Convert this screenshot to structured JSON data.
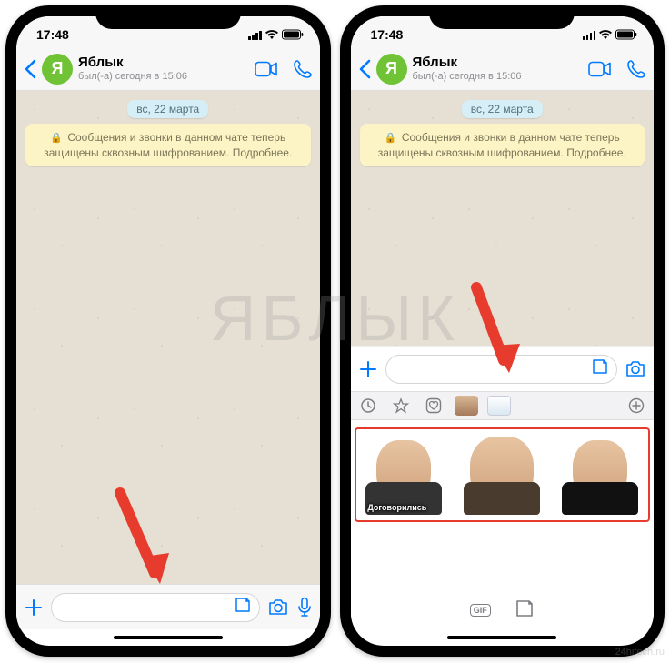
{
  "status": {
    "time": "17:48"
  },
  "chat": {
    "name": "Яблык",
    "subtitle": "был(-а) сегодня в 15:06",
    "avatar_letter": "Я",
    "date_pill": "вс, 22 марта",
    "encryption_notice": "Сообщения и звонки в данном чате теперь защищены сквозным шифрованием.",
    "encryption_more": "Подробнее."
  },
  "sticker_tabs": {
    "items": [
      "recent",
      "favorite",
      "heart",
      "pack-bean",
      "pack-cup"
    ],
    "plus_label": "+"
  },
  "stickers": {
    "row": [
      {
        "id": "bean-1",
        "caption": "Договорились"
      },
      {
        "id": "bean-2",
        "caption": ""
      },
      {
        "id": "bean-3",
        "caption": ""
      }
    ]
  },
  "bottom_switch": {
    "gif_label": "GIF"
  },
  "watermark": "ЯБЛЫК",
  "watermark_site": "24hitech.ru",
  "icons": {
    "back": "chevron-left",
    "video": "video-camera",
    "call": "phone",
    "plus": "plus",
    "sticker": "sticker-sheet",
    "camera": "camera",
    "mic": "microphone",
    "lock": "lock"
  },
  "colors": {
    "accent": "#007aff",
    "avatar_bg": "#6fc335",
    "notice_bg": "#fdf4c5",
    "date_bg": "#d6eef6",
    "chat_bg": "#e6dfd3",
    "arrow_red": "#e73b2d"
  }
}
